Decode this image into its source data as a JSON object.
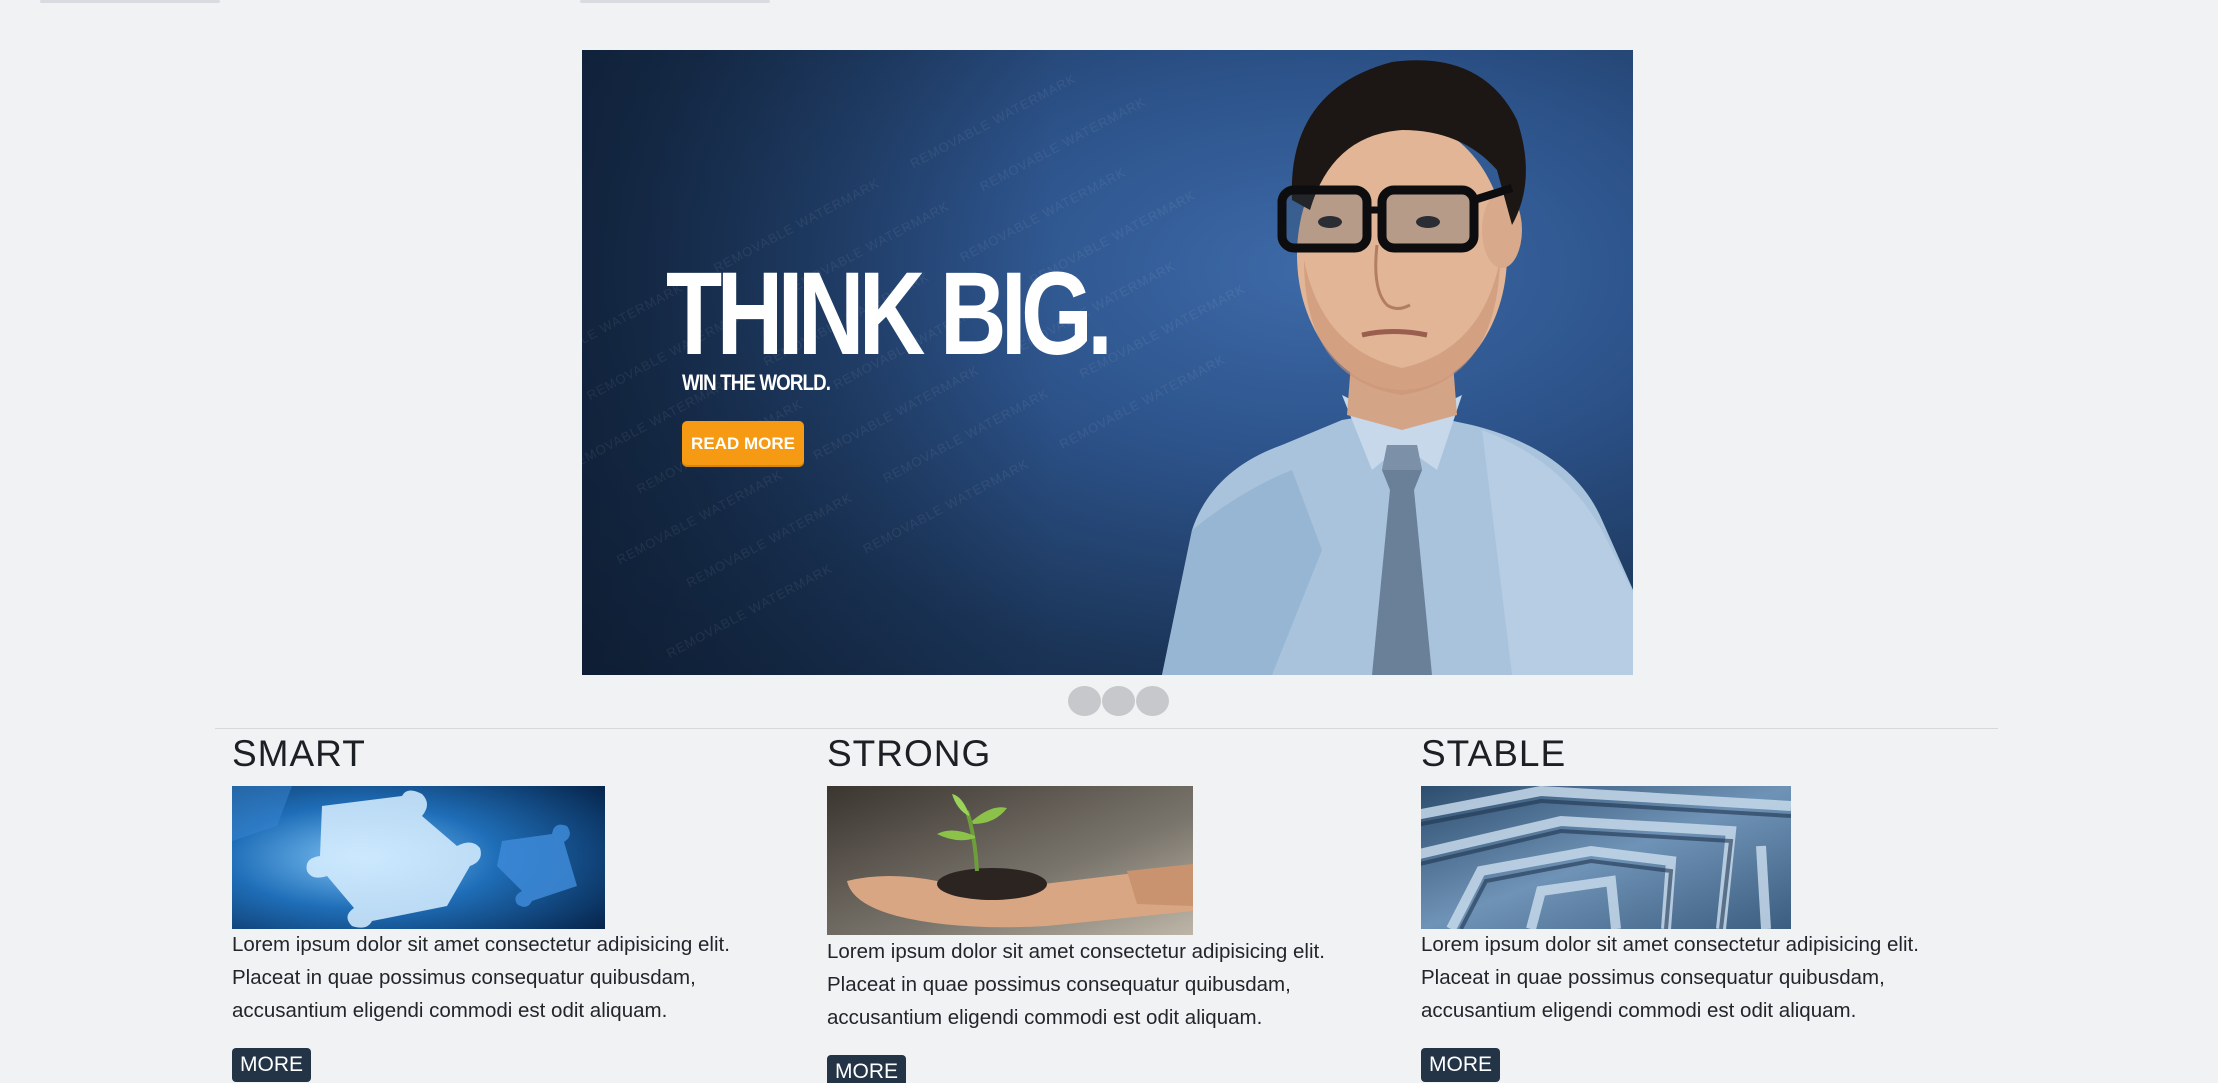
{
  "hero": {
    "headline": "THINK BIG.",
    "subheadline": "WIN THE WORLD.",
    "button_label": "READ MORE",
    "watermark_text": "REMOVABLE WATERMARK",
    "accent_color": "#f59a12",
    "slide_count": 3
  },
  "features": [
    {
      "title": "SMART",
      "image": "puzzle-pieces-image",
      "text_lines": [
        "Lorem ipsum dolor sit amet consectetur adipisicing elit.",
        "Placeat in quae possimus consequatur quibusdam,",
        "accusantium eligendi commodi est odit aliquam."
      ],
      "button_label": "MORE"
    },
    {
      "title": "STRONG",
      "image": "sprout-in-hand-image",
      "text_lines": [
        "Lorem ipsum dolor sit amet consectetur adipisicing elit.",
        "Placeat in quae possimus consequatur quibusdam,",
        "accusantium eligendi commodi est odit aliquam."
      ],
      "button_label": "MORE"
    },
    {
      "title": "STABLE",
      "image": "maze-image",
      "text_lines": [
        "Lorem ipsum dolor sit amet consectetur adipisicing elit.",
        "Placeat in quae possimus consequatur quibusdam,",
        "accusantium eligendi commodi est odit aliquam."
      ],
      "button_label": "MORE"
    }
  ],
  "colors": {
    "background": "#f1f2f4",
    "button_dark": "#243447"
  }
}
